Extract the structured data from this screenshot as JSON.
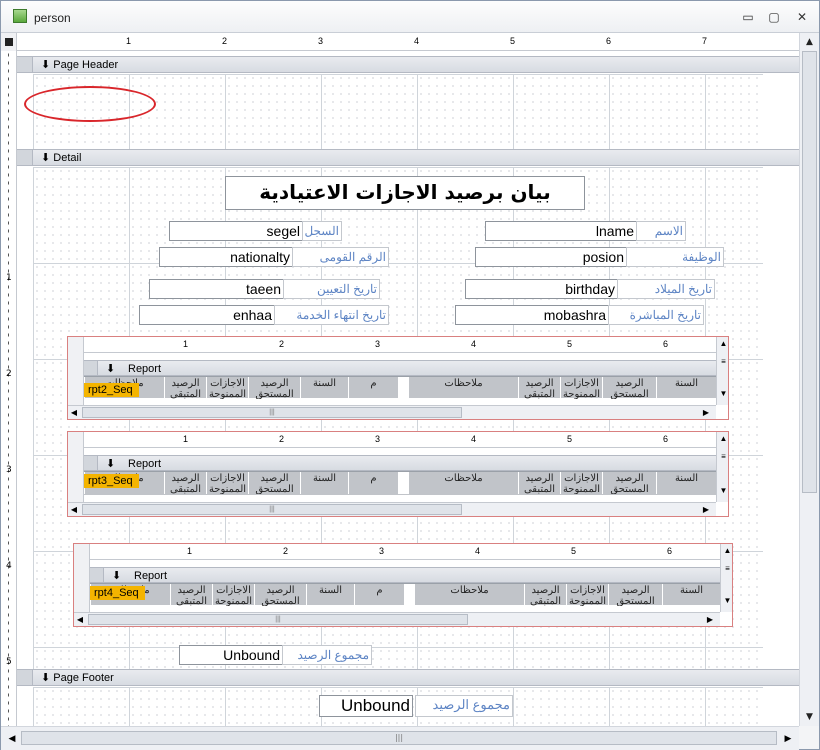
{
  "window": {
    "title": "person",
    "minimize": "▭",
    "restore": "▢",
    "close": "✕"
  },
  "ruler": {
    "top_numbers": [
      "1",
      "2",
      "3",
      "4",
      "5",
      "6",
      "7"
    ],
    "left_numbers": [
      "1",
      "2",
      "3",
      "4",
      "5"
    ]
  },
  "sections": {
    "page_header": "Page Header",
    "detail": "Detail",
    "page_footer": "Page Footer"
  },
  "report_title": "بيان برصيد الاجازات الاعتيادية",
  "fields": {
    "segel": {
      "value": "segel",
      "label": "السجل"
    },
    "lname": {
      "value": "lname",
      "label": "الاسم"
    },
    "nationalty": {
      "value": "nationalty",
      "label": "الرقم القومى"
    },
    "posion": {
      "value": "posion",
      "label": "الوظيفة"
    },
    "taeen": {
      "value": "taeen",
      "label": "تاريخ التعيين"
    },
    "birthday": {
      "value": "birthday",
      "label": "تاريخ الميلاد"
    },
    "enhaa": {
      "value": "enhaa",
      "label": "تاريخ انتهاء الخدمة"
    },
    "mobashra": {
      "value": "mobashra",
      "label": "تاريخ المباشرة"
    }
  },
  "subreports": [
    {
      "seq": "rpt2_Seq",
      "header": "Report Header",
      "ruler_numbers": [
        "1",
        "2",
        "3",
        "4",
        "5",
        "6"
      ]
    },
    {
      "seq": "rpt3_Seq",
      "header": "Report Header",
      "ruler_numbers": [
        "1",
        "2",
        "3",
        "4",
        "5",
        "6"
      ]
    },
    {
      "seq": "rpt4_Seq",
      "header": "Report Header",
      "ruler_numbers": [
        "1",
        "2",
        "3",
        "4",
        "5",
        "6"
      ]
    }
  ],
  "sub_columns": {
    "notes": "ملاحظات",
    "balance": "الرصيد",
    "leaves": "الاجازات",
    "balance_due": "الرصيد",
    "year": "السنة",
    "m": "م",
    "balance_sub": "المتبقى",
    "leaves_sub": "الممنوحة",
    "due_sub": "المستحق"
  },
  "totals": {
    "detail_value": "Unbound",
    "detail_label": "مجموع الرصيد",
    "footer_value": "Unbound",
    "footer_label": "مجموع الرصيد"
  },
  "scroll": {
    "thumb_grip": "|||"
  }
}
